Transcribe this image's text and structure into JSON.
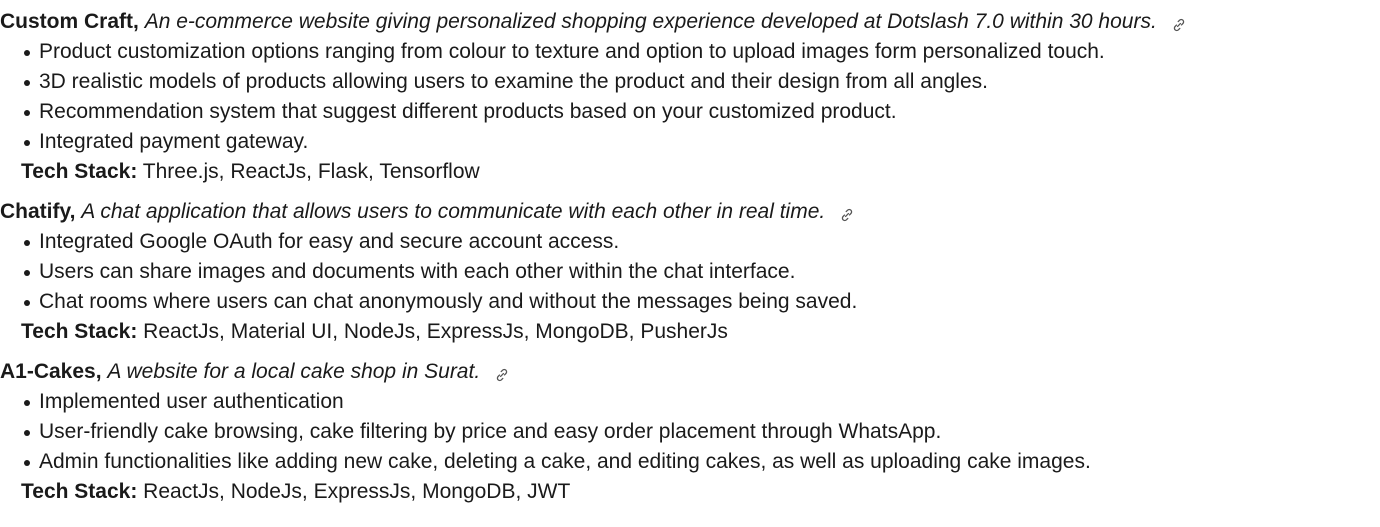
{
  "projects": [
    {
      "name": "Custom Craft,",
      "description": "An e-commerce website giving personalized shopping experience developed at Dotslash 7.0 within 30 hours.",
      "link_icon": "link-icon",
      "bullets": [
        "Product customization options ranging from colour to texture and option to upload images form personalized touch.",
        "3D realistic models of products allowing users to examine the product and their design from all angles.",
        "Recommendation system that suggest different products based on your customized product.",
        "Integrated payment gateway."
      ],
      "tech_label": "Tech Stack:",
      "tech_stack": "Three.js, ReactJs, Flask, Tensorflow"
    },
    {
      "name": "Chatify,",
      "description": "A chat application that allows users to communicate with each other in real time.",
      "link_icon": "link-icon",
      "bullets": [
        "Integrated Google OAuth for easy and secure account access.",
        "Users can share images and documents with each other within the chat interface.",
        "Chat rooms where users can chat anonymously and without the messages being saved."
      ],
      "tech_label": "Tech Stack:",
      "tech_stack": "ReactJs, Material UI, NodeJs, ExpressJs, MongoDB, PusherJs"
    },
    {
      "name": "A1-Cakes,",
      "description": "A website for a local cake shop in Surat.",
      "link_icon": "link-icon",
      "bullets": [
        "Implemented user authentication",
        "User-friendly cake browsing, cake filtering by price and easy order placement through WhatsApp.",
        "Admin functionalities like adding new cake, deleting a cake, and editing cakes, as well as uploading cake images."
      ],
      "tech_label": "Tech Stack:",
      "tech_stack": "ReactJs, NodeJs, ExpressJs, MongoDB, JWT"
    }
  ]
}
